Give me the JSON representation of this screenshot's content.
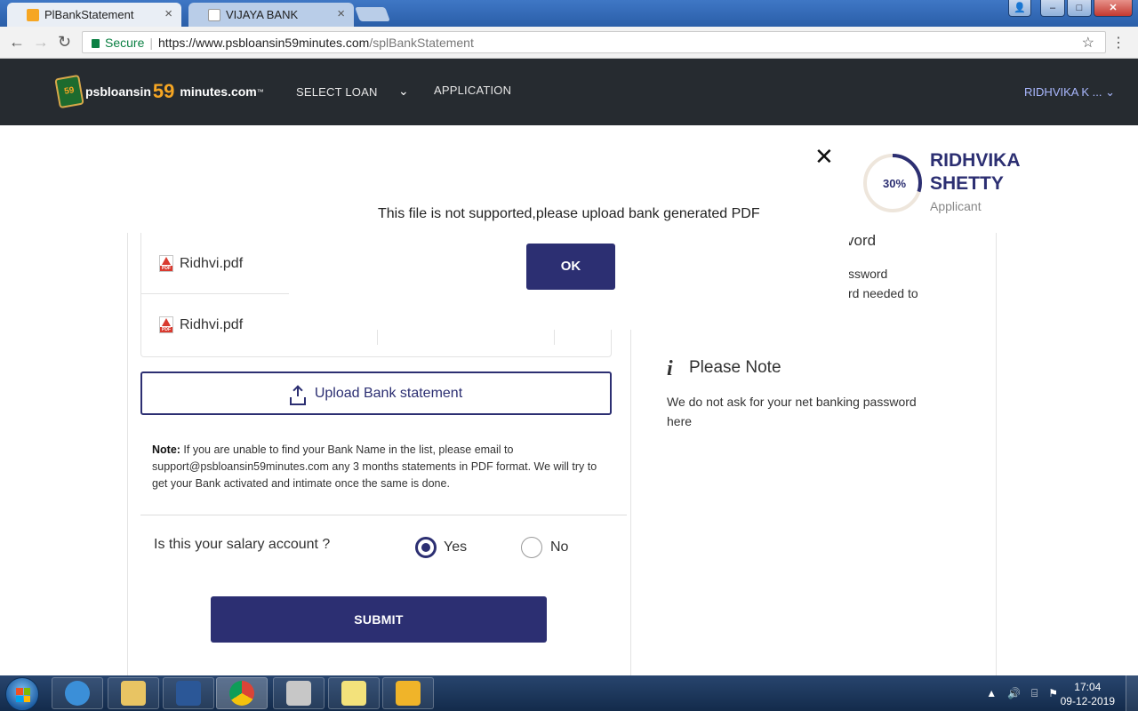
{
  "browser": {
    "tabs": [
      {
        "label": "PlBankStatement",
        "close": "×",
        "active": true
      },
      {
        "label": "VIJAYA BANK",
        "close": "×",
        "active": false
      }
    ],
    "secure_label": "Secure",
    "url_host": "https://www.psbloansin59minutes.com",
    "url_path": "/splBankStatement",
    "window_controls": [
      "–",
      "□",
      "✕"
    ]
  },
  "header": {
    "logo_prefix": "psbloansin",
    "logo_number": "59",
    "logo_suffix": "minutes.com",
    "logo_tm": "™",
    "logo_badge": "59",
    "nav_select_loan": "SELECT LOAN",
    "nav_application": "APPLICATION",
    "user_menu": "RIDHVIKA K ..."
  },
  "modal": {
    "message": "This file is not supported,please upload bank generated PDF",
    "ok_label": "OK",
    "close_glyph": "✕"
  },
  "profile": {
    "progress_percent": 30,
    "progress_label": "30%",
    "name_line1": "RIDHVIKA",
    "name_line2": "SHETTY",
    "role": "Applicant"
  },
  "files": [
    {
      "name": "Ridhvi.pdf"
    },
    {
      "name": "Ridhvi.pdf"
    }
  ],
  "upload": {
    "label": "Upload Bank statement"
  },
  "note": {
    "prefix": "Note:",
    "text": " If you are unable to find your Bank Name in the list, please email to support@psbloansin59minutes.com any 3 months statements in PDF format. We will try to get your Bank activated and intimate once the same is done."
  },
  "salary": {
    "question": "Is this your salary account ?",
    "options": [
      {
        "label": "Yes",
        "checked": true
      },
      {
        "label": "No",
        "checked": false
      }
    ]
  },
  "submit_label": "SUBMIT",
  "password_info": {
    "heading_fragment": "vord",
    "line1": "ssword",
    "line2": "rd needed to"
  },
  "please_note": {
    "icon": "i",
    "heading": "Please Note",
    "text": "We do not ask for your net banking password here"
  },
  "taskbar": {
    "time": "17:04",
    "date": "09-12-2019",
    "tray_icons": [
      "▲",
      "🔊",
      "⌸",
      "⚑"
    ]
  },
  "colors": {
    "brand": "#2c2f72",
    "header_bg": "#262b30",
    "accent_orange": "#f6a623"
  }
}
